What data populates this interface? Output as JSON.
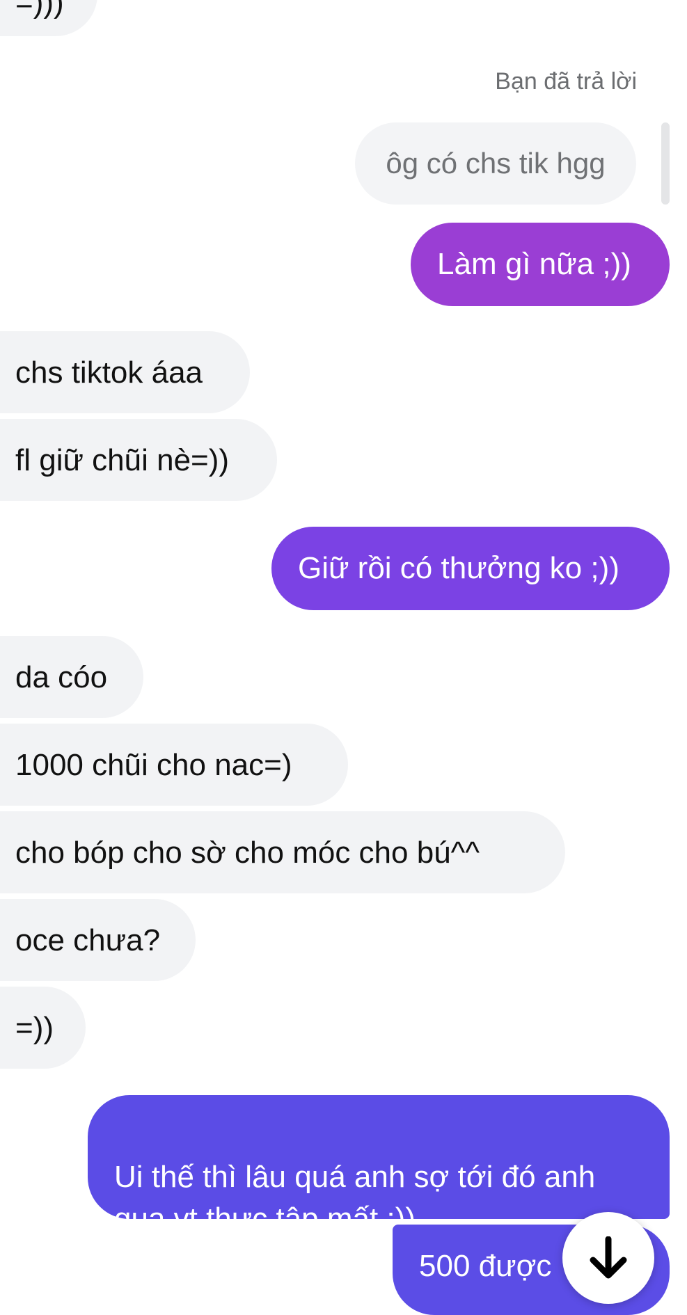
{
  "top_partial_message": "=)))",
  "reply": {
    "label": "Bạn đã trả lời",
    "quoted_text": "ôg có chs tik hgg"
  },
  "messages": [
    {
      "side": "out",
      "text": "Làm gì nữa ;))"
    },
    {
      "side": "in",
      "text": "chs tiktok áaa"
    },
    {
      "side": "in",
      "text": "fl giữ chũi nè=))"
    },
    {
      "side": "out",
      "text": "Giữ rồi có thưởng ko ;))"
    },
    {
      "side": "in",
      "text": "da cóo"
    },
    {
      "side": "in",
      "text": "1000 chũi cho nac=)"
    },
    {
      "side": "in",
      "text": "cho bóp cho sờ cho móc cho bú^^"
    },
    {
      "side": "in",
      "text": "oce chưa?"
    },
    {
      "side": "in",
      "text": "=))"
    },
    {
      "side": "out",
      "text": "Ui thế thì lâu quá anh sợ tới đó anh\nqua vt thực tập mất ;))"
    },
    {
      "side": "out",
      "text": "500 được"
    }
  ],
  "scroll_button": {
    "icon": "arrow-down-icon"
  },
  "colors": {
    "incoming_bg": "#f2f3f5",
    "outgoing_gradient": [
      "#9b3fd3",
      "#7a42e4",
      "#5b4de6"
    ],
    "reply_text": "#6f7174"
  }
}
